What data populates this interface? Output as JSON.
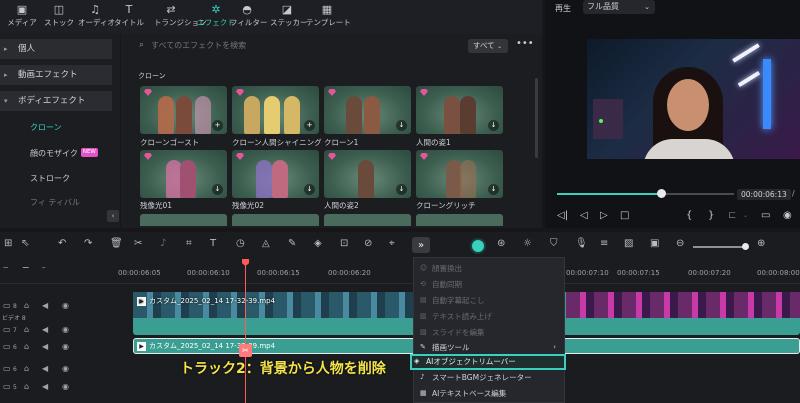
{
  "toolbar": {
    "tabs": [
      {
        "label": "メディア",
        "icon": "media-icon"
      },
      {
        "label": "ストック",
        "icon": "stock-icon"
      },
      {
        "label": "オーディオ",
        "icon": "music-note-icon"
      },
      {
        "label": "タイトル",
        "icon": "text-t-icon"
      },
      {
        "label": "トランジション",
        "icon": "transition-icon"
      },
      {
        "label": "エフェクト",
        "icon": "effects-sparkle-icon",
        "active": true
      },
      {
        "label": "フィルター",
        "icon": "filter-icon"
      },
      {
        "label": "ステッカー",
        "icon": "sticker-icon"
      },
      {
        "label": "テンプレート",
        "icon": "template-icon"
      }
    ]
  },
  "sidebar": {
    "items": [
      {
        "label": "個人"
      },
      {
        "label": "動画エフェクト"
      },
      {
        "label": "ボディエフェクト",
        "expanded": true
      }
    ],
    "subitems": [
      {
        "label": "クローン",
        "selected": true
      },
      {
        "label": "顔のモザイク",
        "badge": "NEW"
      },
      {
        "label": "ストローク"
      },
      {
        "label": "フィ ティバル"
      }
    ]
  },
  "effects": {
    "search_placeholder": "すべてのエフェクトを検索",
    "filter_label": "すべて",
    "section_title": "クローン",
    "items": [
      {
        "name": "クローンゴースト",
        "action": "+"
      },
      {
        "name": "クローン人間シャイニング",
        "action": "+"
      },
      {
        "name": "クローン1",
        "action": "↓"
      },
      {
        "name": "人間の姿1",
        "action": "↓"
      },
      {
        "name": "残像光01",
        "action": "↓"
      },
      {
        "name": "残像光02",
        "action": "↓"
      },
      {
        "name": "人間の姿2",
        "action": "↓"
      },
      {
        "name": "クローングリッチ",
        "action": "↓"
      }
    ]
  },
  "preview": {
    "play_label": "再生",
    "quality": "フル品質",
    "timecode": "00:00:06:13",
    "separator": "/"
  },
  "timeline": {
    "ruler": [
      "00:00:06:05",
      "00:00:06:10",
      "00:00:06:15",
      "00:00:06:20",
      "00:00:07:10",
      "00:00:07:15",
      "00:00:07:20",
      "00:00:08:00"
    ],
    "track_video_label": "ビデオ 8",
    "clip1": "カスタム_2025_02_14 17-32-39.mp4",
    "clip2": "カスタム_2025_02_14 17-32-39.mp4",
    "track_numbers": [
      "8",
      "7",
      "6",
      "6",
      "5"
    ]
  },
  "menu": {
    "items": [
      {
        "label": "顔置換出",
        "enabled": false
      },
      {
        "label": "自動同期",
        "enabled": false
      },
      {
        "label": "自動字幕起こし",
        "enabled": false
      },
      {
        "label": "テキスト読み上げ",
        "enabled": false
      },
      {
        "label": "スライドを編集",
        "enabled": false
      },
      {
        "label": "描画ツール",
        "enabled": true,
        "submenu": true
      },
      {
        "label": "AIオブジェクトリムーバー",
        "enabled": true,
        "highlighted": true
      },
      {
        "label": "スマートBGMジェネレーター",
        "enabled": true
      },
      {
        "label": "AIテキストベース編集",
        "enabled": true
      }
    ]
  },
  "caption": "トラック2：背景から人物を削除"
}
